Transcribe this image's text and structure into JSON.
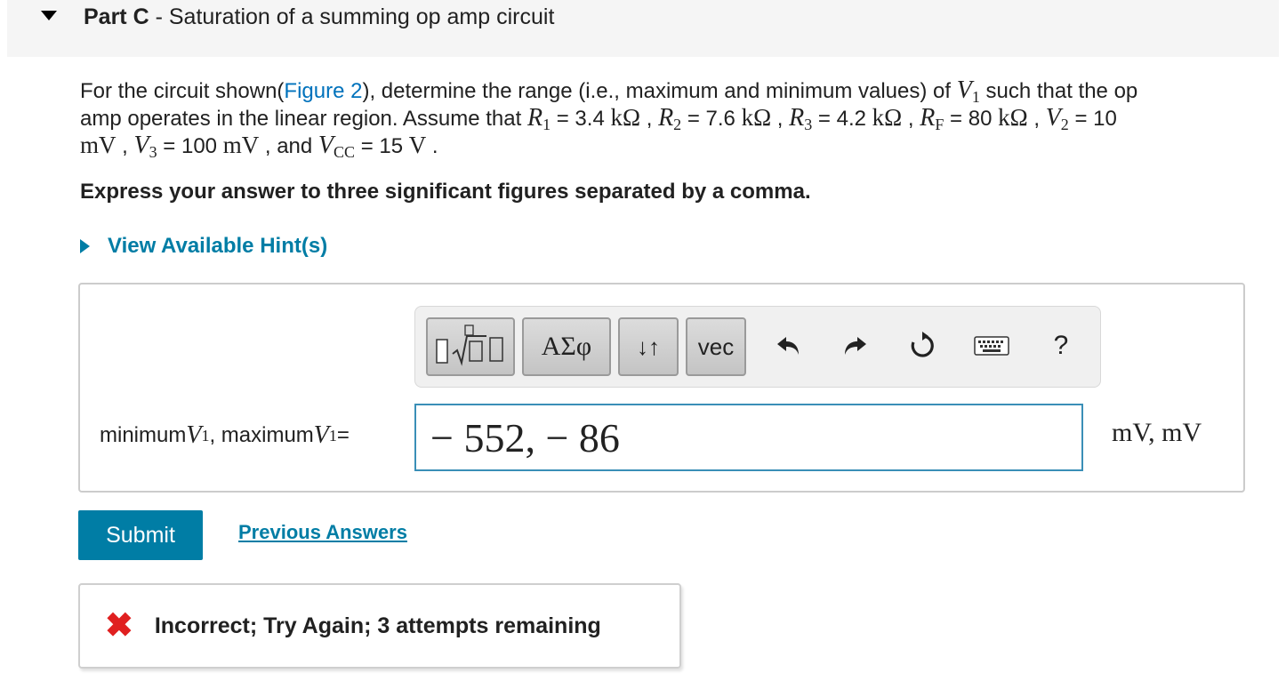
{
  "header": {
    "part_label": "Part C",
    "separator": " - ",
    "title": "Saturation of a summing op amp circuit"
  },
  "problem": {
    "text_1": "For the circuit shown(",
    "figure_link": "Figure 2",
    "text_2": "), determine the range (i.e., maximum and minimum values) of ",
    "text_3": " such that the op",
    "text_4": "amp operates in the linear region. Assume that ",
    "r1": " = 3.4 ",
    "r2": " = 7.6 ",
    "r3": " = 4.2 ",
    "rf": " = 80 ",
    "v2": " = 10",
    "v3": " = 100 ",
    "and": " , and ",
    "vcc": " = 15 ",
    "end": " ."
  },
  "instruction": "Express your answer to three significant figures separated by a comma.",
  "hint": {
    "label": "View Available Hint(s)"
  },
  "toolbar": {
    "greek_label": "ΑΣφ",
    "sort_label": "↓↑",
    "vec_label": "vec",
    "help_label": "?"
  },
  "answer": {
    "label_min": "minimum ",
    "label_max": ", maximum ",
    "equals": " =",
    "value": "− 552, − 86",
    "units": "mV, mV"
  },
  "submit_label": "Submit",
  "previous_answers_label": "Previous Answers",
  "feedback": {
    "icon": "✖",
    "text": "Incorrect; Try Again; 3 attempts remaining"
  },
  "colors": {
    "link": "#0072bc",
    "accent": "#007da5",
    "error": "#e02020",
    "input_border": "#3a8fb7"
  },
  "icons": [
    "collapse-arrow-icon",
    "hint-arrow-icon",
    "templates-icon",
    "undo-icon",
    "redo-icon",
    "reset-icon",
    "keyboard-icon",
    "help-icon",
    "error-x-icon"
  ]
}
